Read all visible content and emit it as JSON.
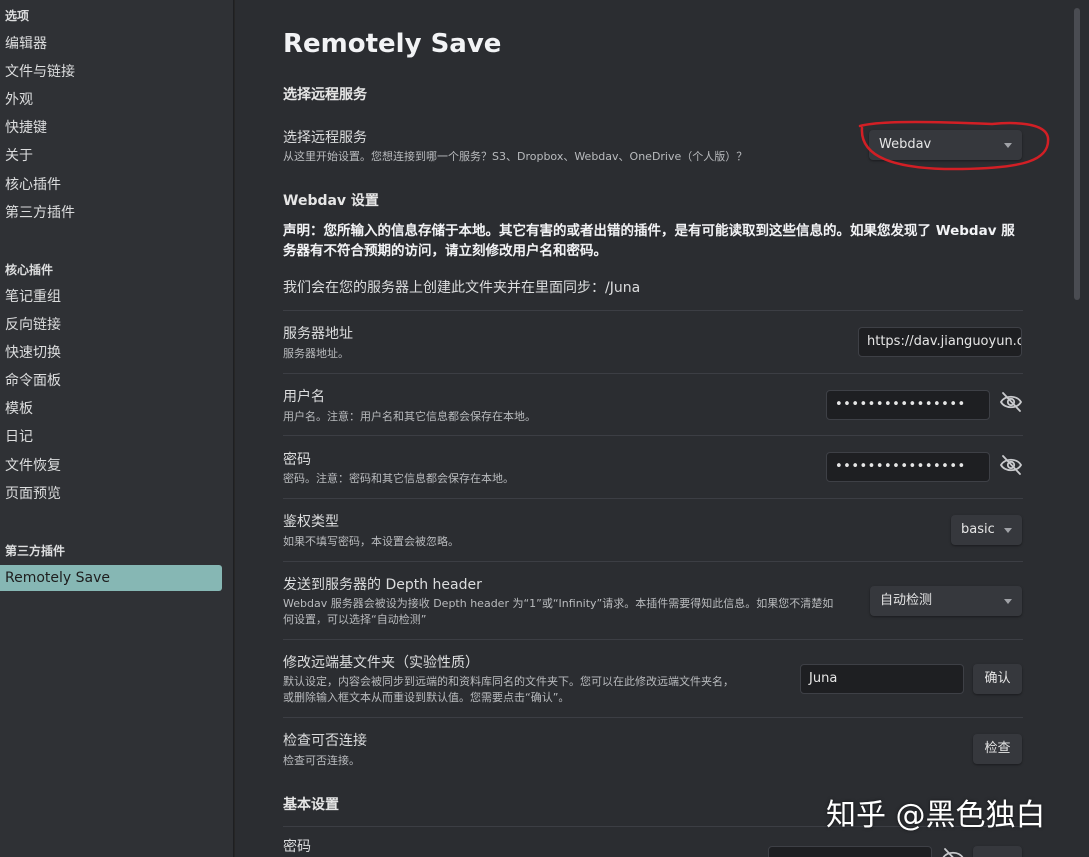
{
  "sidebar": {
    "options_title": "选项",
    "options_items": [
      "编辑器",
      "文件与链接",
      "外观",
      "快捷键",
      "关于",
      "核心插件",
      "第三方插件"
    ],
    "core_title": "核心插件",
    "core_items": [
      "笔记重组",
      "反向链接",
      "快速切换",
      "命令面板",
      "模板",
      "日记",
      "文件恢复",
      "页面预览"
    ],
    "community_title": "第三方插件",
    "active_item": "Remotely Save"
  },
  "page": {
    "title": "Remotely Save",
    "choose_service_heading": "选择远程服务",
    "service": {
      "name": "选择远程服务",
      "desc": "从这里开始设置。您想连接到哪一个服务？S3、Dropbox、Webdav、OneDrive（个人版）？",
      "value": "Webdav"
    },
    "webdav_heading": "Webdav 设置",
    "warning": "声明：您所输入的信息存储于本地。其它有害的或者出错的插件，是有可能读取到这些信息的。如果您发现了 Webdav 服务器有不符合预期的访问，请立刻修改用户名和密码。",
    "folder_note": "我们会在您的服务器上创建此文件夹并在里面同步：/Juna",
    "server": {
      "name": "服务器地址",
      "desc": "服务器地址。",
      "value": "https://dav.jianguoyun.co"
    },
    "username": {
      "name": "用户名",
      "desc": "用户名。注意：用户名和其它信息都会保存在本地。",
      "value": "••••••••••••••••"
    },
    "password": {
      "name": "密码",
      "desc": "密码。注意：密码和其它信息都会保存在本地。",
      "value": "••••••••••••••••"
    },
    "auth": {
      "name": "鉴权类型",
      "desc": "如果不填写密码，本设置会被忽略。",
      "value": "basic"
    },
    "depth": {
      "name": "发送到服务器的 Depth header",
      "desc1": "Webdav 服务器会被设为接收 Depth header 为“1”或“Infinity”请求。本插件需要得知此信息。如果您不清楚如",
      "desc2": "何设置，可以选择“自动检测”",
      "value": "自动检测"
    },
    "remote_folder": {
      "name": "修改远端基文件夹（实验性质）",
      "desc1": "默认设定，内容会被同步到远端的和资料库同名的文件夹下。您可以在此修改远端文件夹名，",
      "desc2": "或删除输入框文本从而重设到默认值。您需要点击“确认”。",
      "value": "Juna",
      "confirm": "确认"
    },
    "check": {
      "name": "检查可否连接",
      "desc": "检查可否连接。",
      "button": "检查"
    },
    "basic_heading": "基本设置",
    "basic_password": {
      "name": "密码"
    }
  },
  "watermark": "知乎 @黑色独白",
  "colors": {
    "accent_active": "#86b7b4",
    "highlight_circle": "#d21f25"
  }
}
